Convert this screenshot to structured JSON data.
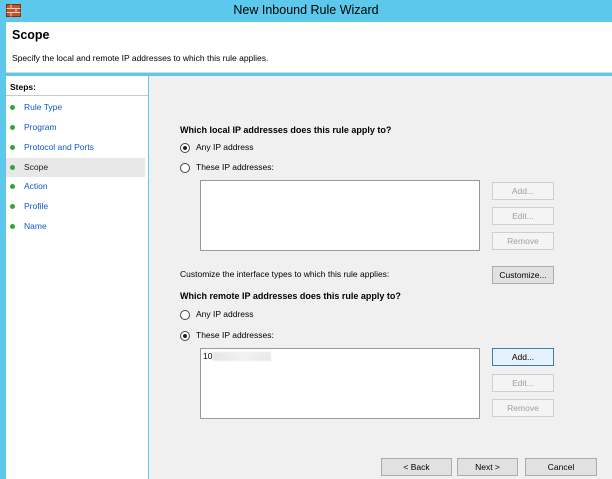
{
  "window": {
    "title": "New Inbound Rule Wizard"
  },
  "header": {
    "title": "Scope",
    "description": "Specify the local and remote IP addresses to which this rule applies."
  },
  "steps": {
    "title": "Steps:",
    "items": [
      {
        "label": "Rule Type"
      },
      {
        "label": "Program"
      },
      {
        "label": "Protocol and Ports"
      },
      {
        "label": "Scope"
      },
      {
        "label": "Action"
      },
      {
        "label": "Profile"
      },
      {
        "label": "Name"
      }
    ]
  },
  "local": {
    "heading": "Which local IP addresses does this rule apply to?",
    "any_label": "Any IP address",
    "these_label": "These IP addresses:",
    "selected": "any",
    "add_label": "Add...",
    "edit_label": "Edit...",
    "remove_label": "Remove"
  },
  "customize": {
    "text": "Customize the interface types to which this rule applies:",
    "button_label": "Customize..."
  },
  "remote": {
    "heading": "Which remote IP addresses does this rule apply to?",
    "any_label": "Any IP address",
    "these_label": "These IP addresses:",
    "selected": "these",
    "entries": [
      "10"
    ],
    "add_label": "Add...",
    "edit_label": "Edit...",
    "remove_label": "Remove"
  },
  "footer": {
    "back_label": "< Back",
    "next_label": "Next >",
    "cancel_label": "Cancel"
  },
  "colors": {
    "title_bar": "#5bc8ec",
    "step_dot": "#34a33a",
    "step_link": "#1155cc"
  }
}
